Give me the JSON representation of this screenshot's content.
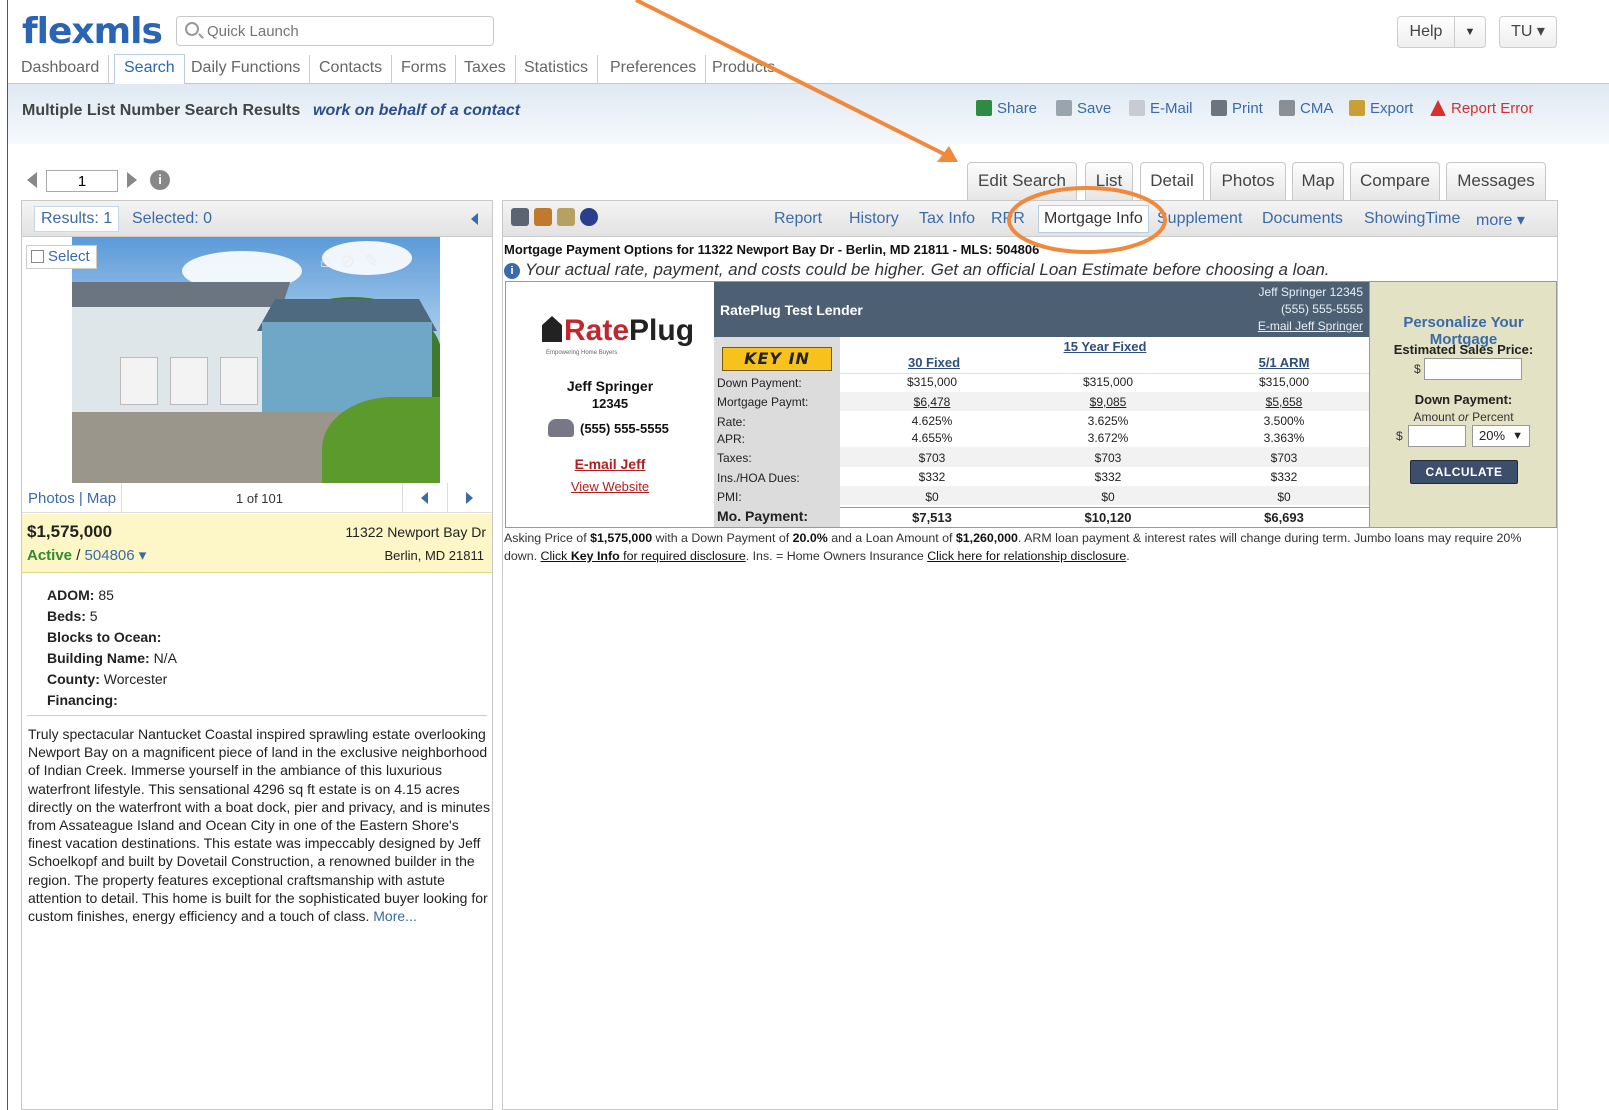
{
  "header": {
    "logo": "flexmls",
    "quick_launch_placeholder": "Quick Launch",
    "help_label": "Help",
    "help_dropdown": "▼",
    "user_label": "TU ▾"
  },
  "nav_tabs": [
    "Dashboard",
    "Search",
    "Daily Functions",
    "Contacts",
    "Forms",
    "Taxes",
    "Statistics",
    "Preferences",
    "Products"
  ],
  "subheader": {
    "title": "Multiple List Number Search Results",
    "contact_link": "work on behalf of a contact",
    "actions": [
      "Share",
      "Save",
      "E-Mail",
      "Print",
      "CMA",
      "Export",
      "Report Error"
    ]
  },
  "pager": {
    "page": "1"
  },
  "view_tabs": [
    "Edit Search",
    "List",
    "Detail",
    "Photos",
    "Map",
    "Compare",
    "Messages"
  ],
  "left_panel": {
    "results_label": "Results: 1",
    "selected_label": "Selected: 0",
    "select_label": "Select",
    "photos_map": "Photos | Map",
    "photo_count": "1 of 101",
    "price": "$1,575,000",
    "status": "Active",
    "mls_number": "504806",
    "address_line1": "11322 Newport Bay Dr",
    "address_line2": "Berlin, MD 21811",
    "facts": [
      {
        "label": "ADOM:",
        "value": "85"
      },
      {
        "label": "Beds:",
        "value": "5"
      },
      {
        "label": "Blocks to Ocean:",
        "value": ""
      },
      {
        "label": "Building Name:",
        "value": "N/A"
      },
      {
        "label": "County:",
        "value": "Worcester"
      },
      {
        "label": "Financing:",
        "value": ""
      }
    ],
    "description": "Truly spectacular Nantucket Coastal inspired sprawling estate overlooking Newport Bay on a magnificent piece of land in the exclusive neighborhood of Indian Creek. Immerse yourself in the ambiance of this luxurious waterfront lifestyle. This sensational 4296 sq ft estate is on 4.15 acres directly on the waterfront with a boat dock, pier and privacy, and is minutes from Assateague Island and Ocean City in one of the Eastern Shore's finest vacation destinations. This estate was impeccably designed by Jeff Schoelkopf and built by Dovetail Construction, a renowned builder in the region. The property features exceptional craftsmanship with astute attention to detail. This home is built for the sophisticated buyer looking for custom finishes, energy efficiency and a touch of class.",
    "more_label": "More..."
  },
  "detail_tabs": [
    "Report",
    "History",
    "Tax Info",
    "RPR",
    "Mortgage Info",
    "Supplement",
    "Documents",
    "ShowingTime",
    "more ▾"
  ],
  "mortgage": {
    "title": "Mortgage Payment Options for 11322 Newport Bay Dr - Berlin, MD 21811 - MLS: 504806",
    "disclaimer": "Your actual rate, payment, and costs could be higher. Get an official Loan Estimate before choosing a loan.",
    "logo_rate": "Rate",
    "logo_plug": "Plug",
    "logo_tagline": "Empowering Home Buyers",
    "lender_agent_name": "Jeff Springer",
    "lender_agent_id": "12345",
    "lender_phone": "(555) 555-5555",
    "email_label": "E-mail Jeff",
    "website_label": "View Website",
    "lender_name": "RatePlug Test Lender",
    "contact_line1": "Jeff Springer 12345",
    "contact_line2": "(555) 555-5555",
    "contact_email": "E-mail Jeff Springer",
    "key_in": "KEY IN",
    "columns": [
      "30 Fixed",
      "15 Year Fixed",
      "5/1 ARM"
    ],
    "rows": [
      {
        "label": "Down Payment:",
        "values": [
          "$315,000",
          "$315,000",
          "$315,000"
        ]
      },
      {
        "label": "Mortgage Paymt:",
        "values": [
          "$6,478",
          "$9,085",
          "$5,658"
        ]
      },
      {
        "label": "Rate:",
        "values": [
          "4.625%",
          "3.625%",
          "3.500%"
        ]
      },
      {
        "label": "APR:",
        "values": [
          "4.655%",
          "3.672%",
          "3.363%"
        ]
      },
      {
        "label": "Taxes:",
        "values": [
          "$703",
          "$703",
          "$703"
        ]
      },
      {
        "label": "Ins./HOA Dues:",
        "values": [
          "$332",
          "$332",
          "$332"
        ]
      },
      {
        "label": "PMI:",
        "values": [
          "$0",
          "$0",
          "$0"
        ]
      },
      {
        "label": "Mo. Payment:",
        "values": [
          "$7,513",
          "$10,120",
          "$6,693"
        ]
      }
    ],
    "personalize_title": "Personalize Your Mortgage",
    "est_sales_label": "Estimated Sales Price:",
    "dollar_sign": "$",
    "down_payment_label": "Down Payment:",
    "amount_or_percent_amount": "Amount",
    "amount_or_percent_or": "or",
    "amount_or_percent_percent": "Percent",
    "percent_value": "20%",
    "calculate_label": "CALCULATE",
    "footnote": {
      "t1": "Asking Price of ",
      "price": "$1,575,000",
      "t2": " with a Down Payment of ",
      "down": "20.0%",
      "t3": " and a Loan Amount of ",
      "loan": "$1,260,000",
      "t4": ". ARM loan payment & interest rates will change during term. Jumbo loans may require 20% down. ",
      "link1_pre": "Click ",
      "link1_bold": "Key Info",
      "link1_post": " for required disclosure",
      "t5": ". Ins. = Home Owners Insurance ",
      "link2": "Click here for relationship disclosure",
      "t6": "."
    }
  },
  "colors": {
    "accent": "#2a64b4",
    "link": "#3a6aa8",
    "annotation": "#f0893c",
    "report_error": "#d43030",
    "active_green": "#2e8b2e",
    "widget_header": "#4c5f73",
    "personalize_bg": "#e3e2c4",
    "key_in_bg": "#f7c21c"
  }
}
